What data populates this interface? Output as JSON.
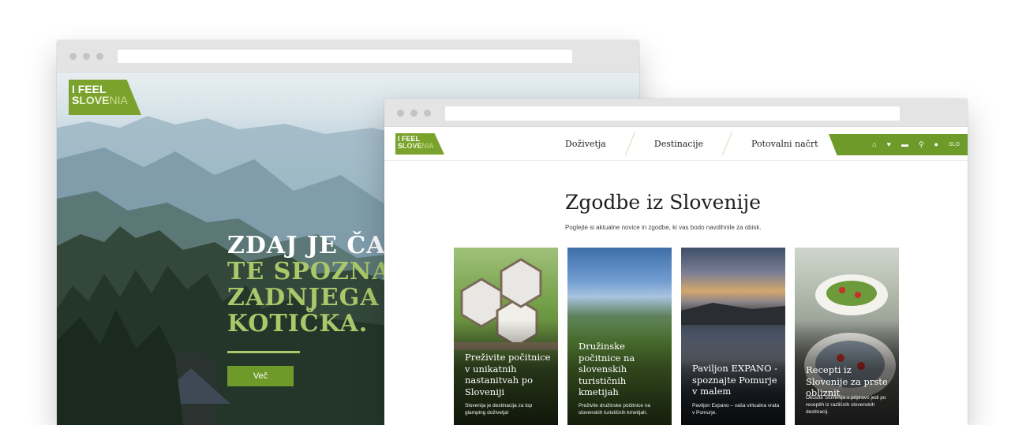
{
  "back_window": {
    "logo": {
      "line1": "I FEEL",
      "line2_a": "S",
      "line2_b": "LOVE",
      "line2_c": "NIA"
    },
    "hero": {
      "title_lines": [
        "ZDAJ JE ČAS",
        "TE SPOZNAM",
        "ZADNJEGA",
        "KOTIČKA."
      ],
      "button_label": "Več"
    }
  },
  "front_window": {
    "logo": {
      "line1": "I FEEL",
      "line2_a": "S",
      "line2_b": "LOVE",
      "line2_c": "NIA"
    },
    "nav": {
      "items": [
        {
          "label": "Doživetja"
        },
        {
          "label": "Destinacije"
        },
        {
          "label": "Potovalni načrt"
        }
      ],
      "icons": [
        "home-icon",
        "heart-icon",
        "bed-icon",
        "search-icon",
        "chat-icon"
      ],
      "language": "SLO"
    },
    "title": "Zgodbe iz Slovenije",
    "subtitle": "Poglejte si aktualne novice in zgodbe, ki vas bodo navdihnile za obisk.",
    "cards": [
      {
        "title": "Preživite počitnice v unikatnih nastanitvah po Sloveniji",
        "desc": "Slovenija je destinacija za top glamping doživetja!"
      },
      {
        "title": "Družinske počitnice na slovenskih turističnih kmetijah",
        "desc": "Preživite družinske počitnice na slovenskih turističnih kmetijah."
      },
      {
        "title": "Paviljon EXPANO - spoznajte Pomurje v malem",
        "desc": "Paviljon Expano – vaša virtualna vrata v Pomurje."
      },
      {
        "title": "Recepti iz Slovenije za prste obliznit",
        "desc": "Okusite Slovenijo s pripravo jedi po receptih iz različnih slovenskih destinacij."
      }
    ]
  },
  "colors": {
    "brand_green": "#6e9a2a",
    "accent_green": "#a9c86a",
    "chrome_gray": "#e4e4e4"
  }
}
